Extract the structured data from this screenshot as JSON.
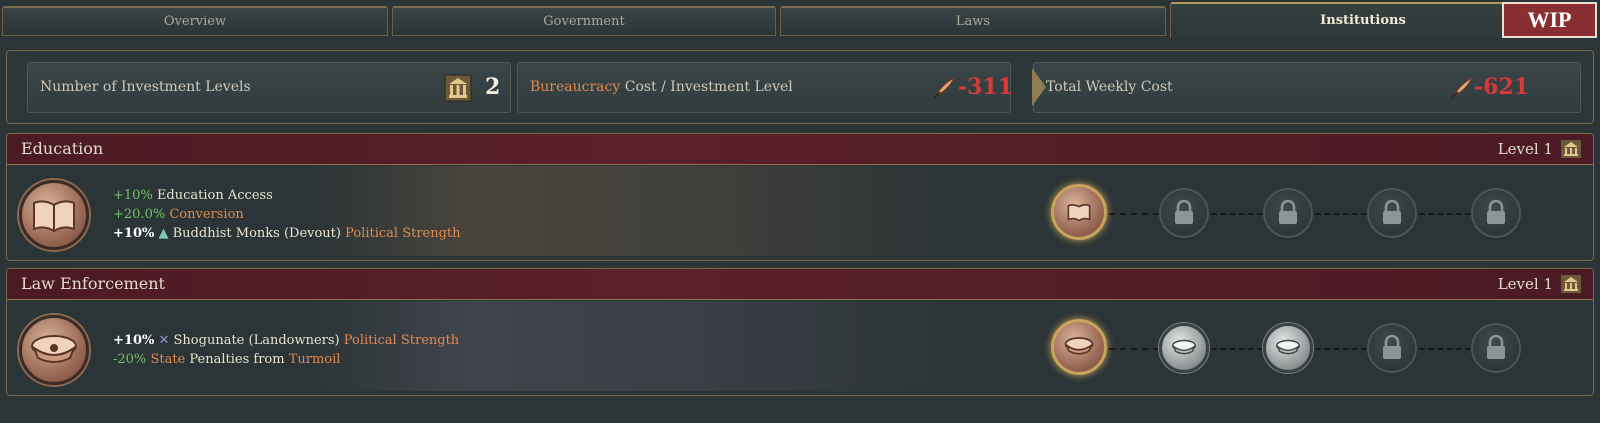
{
  "tabs": [
    {
      "label": "Overview"
    },
    {
      "label": "Government"
    },
    {
      "label": "Laws"
    },
    {
      "label": "Institutions",
      "active": true
    }
  ],
  "wip_badge": "WIP",
  "summary": {
    "investment_levels": {
      "label": "Number of Investment Levels",
      "value": "2",
      "icon": "institution-icon"
    },
    "cost_per_level": {
      "label_highlight": "Bureaucracy",
      "label_rest": " Cost / Investment Level",
      "value": "-311",
      "icon": "bureaucracy-quill-icon"
    },
    "total_weekly_cost": {
      "label": "Total Weekly Cost",
      "value": "-621",
      "icon": "bureaucracy-quill-icon"
    }
  },
  "institutions": [
    {
      "name": "Education",
      "level_text": "Level 1",
      "icon": "book-icon",
      "effects": {
        "line1_value": "+10%",
        "line1_label": "Education Access",
        "line2_value": "+20.0%",
        "line2_label": "Conversion",
        "line3_value": "+10%",
        "line3_group": "Buddhist Monks (Devout)",
        "line3_suffix": "Political Strength"
      },
      "slots": [
        "active",
        "locked",
        "locked",
        "locked",
        "locked"
      ]
    },
    {
      "name": "Law Enforcement",
      "level_text": "Level 1",
      "icon": "police-cap-icon",
      "effects": {
        "line1_value": "+10%",
        "line1_group": "Shogunate (Landowners)",
        "line1_suffix": "Political Strength",
        "line2_value": "-20%",
        "line2_highlight": "State",
        "line2_middle": " Penalties from ",
        "line2_end": "Turmoil"
      },
      "slots": [
        "active",
        "available",
        "available",
        "locked",
        "locked"
      ]
    }
  ],
  "colors": {
    "accent_gold": "#b59a5a",
    "negative_red": "#d83a3a",
    "positive_green": "#74c26a",
    "highlight_orange": "#e08a52",
    "wip_red": "#8a2f31"
  }
}
